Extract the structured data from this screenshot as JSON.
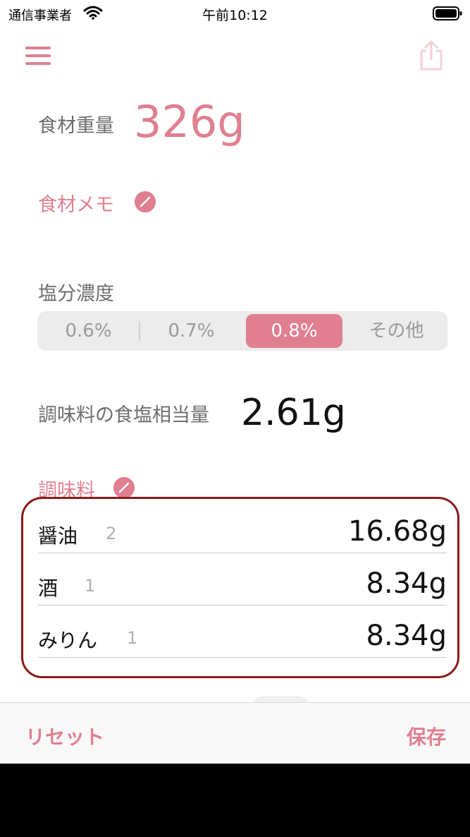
{
  "status_bar": {
    "carrier": "通信事業者",
    "time": "午前10:12"
  },
  "toolbar": {
    "menu_icon": "hamburger-menu-icon",
    "share_icon": "share-icon"
  },
  "ingredient": {
    "weight_label": "食材重量",
    "weight_value": "326g",
    "memo_label": "食材メモ"
  },
  "salt_concentration": {
    "label": "塩分濃度",
    "options": [
      "0.6%",
      "0.7%",
      "0.8%",
      "その他"
    ],
    "selected": "0.8%"
  },
  "salt_equivalent": {
    "label": "調味料の食塩相当量",
    "value": "2.61g"
  },
  "seasonings": {
    "label": "調味料",
    "items": [
      {
        "name": "醤油",
        "count": "2",
        "amount": "16.68g"
      },
      {
        "name": "酒",
        "count": "1",
        "amount": "8.34g"
      },
      {
        "name": "みりん",
        "count": "1",
        "amount": "8.34g"
      }
    ]
  },
  "bottom_bar": {
    "reset_label": "リセット",
    "save_label": "保存"
  },
  "colors": {
    "accent": "#e07f90",
    "highlight_border": "#8b1a1a"
  }
}
